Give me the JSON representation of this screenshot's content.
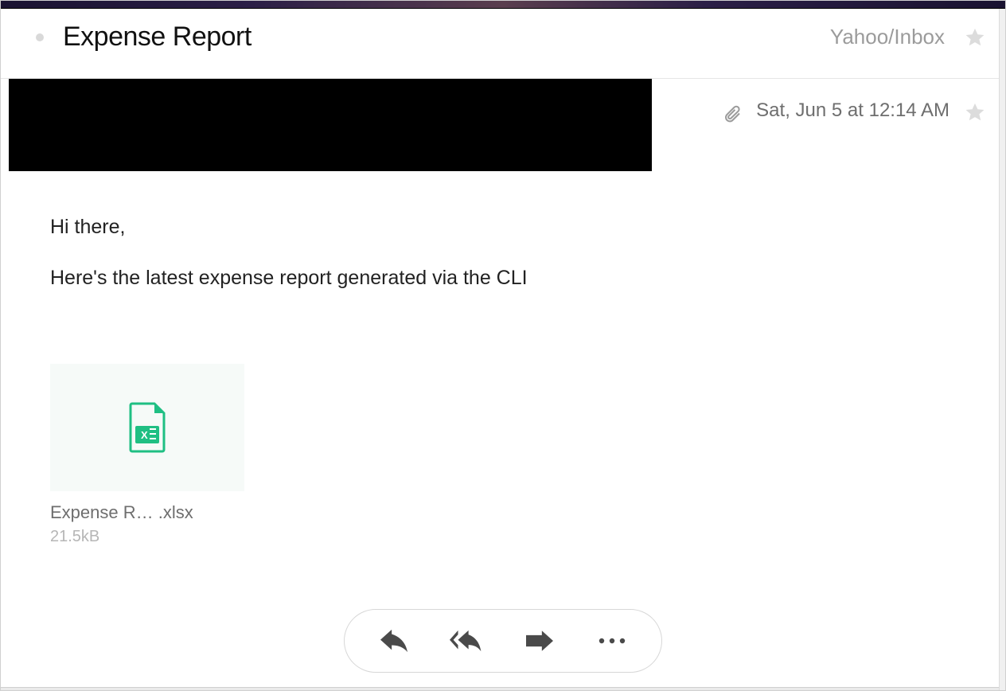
{
  "header": {
    "subject": "Expense Report",
    "folder": "Yahoo/Inbox"
  },
  "message": {
    "date": "Sat, Jun 5 at 12:14 AM",
    "greeting": "Hi there,",
    "body_line": "Here's the latest expense report generated via the CLI"
  },
  "attachment": {
    "name_display": "Expense R… .xlsx",
    "size": "21.5kB",
    "icon": "excel-file-icon"
  },
  "actions": {
    "reply": "Reply",
    "reply_all": "Reply All",
    "forward": "Forward",
    "more": "More"
  }
}
